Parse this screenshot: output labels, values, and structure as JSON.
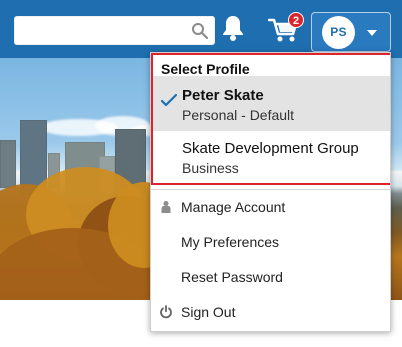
{
  "search": {
    "value": "",
    "placeholder": ""
  },
  "cart": {
    "badge_count": "2"
  },
  "profile_button": {
    "initials": "PS"
  },
  "menu": {
    "profile_heading": "Select Profile",
    "profiles": [
      {
        "name": "Peter Skate",
        "subtitle": "Personal - Default",
        "selected": true
      },
      {
        "name": "Skate Development Group",
        "subtitle": "Business",
        "selected": false
      }
    ],
    "items": [
      {
        "label": "Manage Account",
        "icon": "user-icon"
      },
      {
        "label": "My Preferences",
        "icon": ""
      },
      {
        "label": "Reset Password",
        "icon": ""
      },
      {
        "label": "Sign Out",
        "icon": "power-icon"
      }
    ]
  },
  "colors": {
    "header": "#1f6fb0",
    "badge": "#d9252b",
    "selected_row": "#e3e3e3",
    "profile_border": "#d9252b",
    "check": "#1f6fb0"
  }
}
